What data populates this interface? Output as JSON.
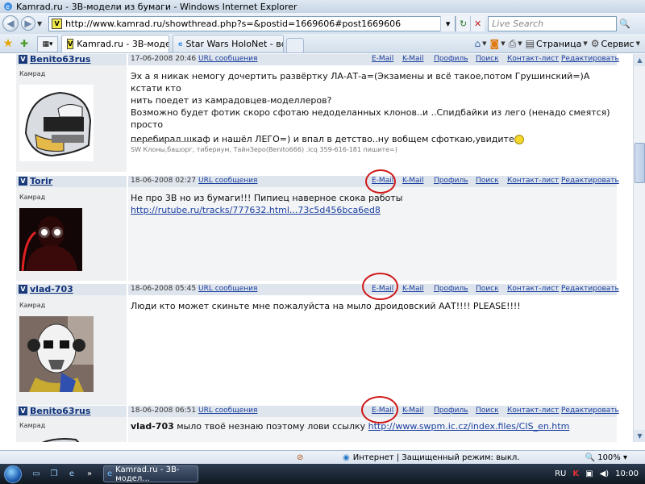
{
  "window": {
    "title": "Kamrad.ru - 3B-модели из бумаги - Windows Internet Explorer"
  },
  "address": {
    "url": "http://www.kamrad.ru/showthread.php?s=&postid=1669606#post1669606",
    "search_placeholder": "Live Search"
  },
  "tabs": [
    {
      "label": "Kamrad.ru - 3B-модел...",
      "active": true
    },
    {
      "label": "Star Wars HoloNet - все о ...",
      "active": false
    }
  ],
  "commands": {
    "page": "Страница",
    "tools": "Сервис"
  },
  "posts": [
    {
      "user": "Benito63rus",
      "rank": "Камрад",
      "date": "17-06-2008",
      "time": "20:46",
      "url_label": "URL сообщения",
      "email": "E-Mail",
      "kmail": "K-Mail",
      "profile": "Профиль",
      "search": "Поиск",
      "contacts": "Контакт-лист",
      "edit": "Редактировать",
      "lines": [
        "Эх а я никак немогу дочертить развёртку ЛА-АТ-а=(Экзамены и всё такое,потом Грушинский=)А кстати кто",
        "нить поедет из камрадовцев-моделлеров?",
        "Возможно будет фотик скоро сфотаю недоделанных клонов..и ..Спидбайки из лего (ненадо смеятся) просто",
        "перебирал шкаф и нашёл ЛЕГО=) и впал в детство..ну вобщем сфоткаю,увидите"
      ],
      "signature": "SW Клоны,башорг, тибериум, ТайнЗеро(Benito666) .icq 359-616-181 пишите=)"
    },
    {
      "user": "Torir",
      "rank": "Камрад",
      "date": "18-06-2008",
      "time": "02:27",
      "url_label": "URL сообщения",
      "email": "E-Mail",
      "kmail": "K-Mail",
      "profile": "Профиль",
      "search": "Поиск",
      "contacts": "Контакт-лист",
      "edit": "Редактировать",
      "line1": "Не про 3B но из бумаги!!! Пипиец наверное скока работы",
      "link": "http://rutube.ru/tracks/777632.html...73c5d456bca6ed8"
    },
    {
      "user": "vlad-703",
      "rank": "Камрад",
      "date": "18-06-2008",
      "time": "05:45",
      "url_label": "URL сообщения",
      "email": "E-Mail",
      "kmail": "K-Mail",
      "profile": "Профиль",
      "search": "Поиск",
      "contacts": "Контакт-лист",
      "edit": "Редактировать",
      "line1": "Люди кто может скиньте мне пожалуйста на мыло дроидовский ААТ!!!! PLEASE!!!!"
    },
    {
      "user": "Benito63rus",
      "rank": "Камрад",
      "date": "18-06-2008",
      "time": "06:51",
      "url_label": "URL сообщения",
      "email": "E-Mail",
      "kmail": "K-Mail",
      "profile": "Профиль",
      "search": "Поиск",
      "contacts": "Контакт-лист",
      "edit": "Редактировать",
      "bold": "vlad-703",
      "text": " мыло твоё незнаю поэтому лови ссылку ",
      "link": "http://www.swpm.ic.cz/index.files/CIS_en.htm"
    }
  ],
  "status": {
    "zone": "Интернет | Защищенный режим: выкл.",
    "zoom": "100%"
  },
  "taskbar": {
    "task": "Kamrad.ru - 3B-модел...",
    "lang": "RU",
    "clock": "10:00"
  },
  "colors": {
    "annotation": "#d01818",
    "link": "#1a3fa0",
    "header": "#dfe5ec"
  }
}
